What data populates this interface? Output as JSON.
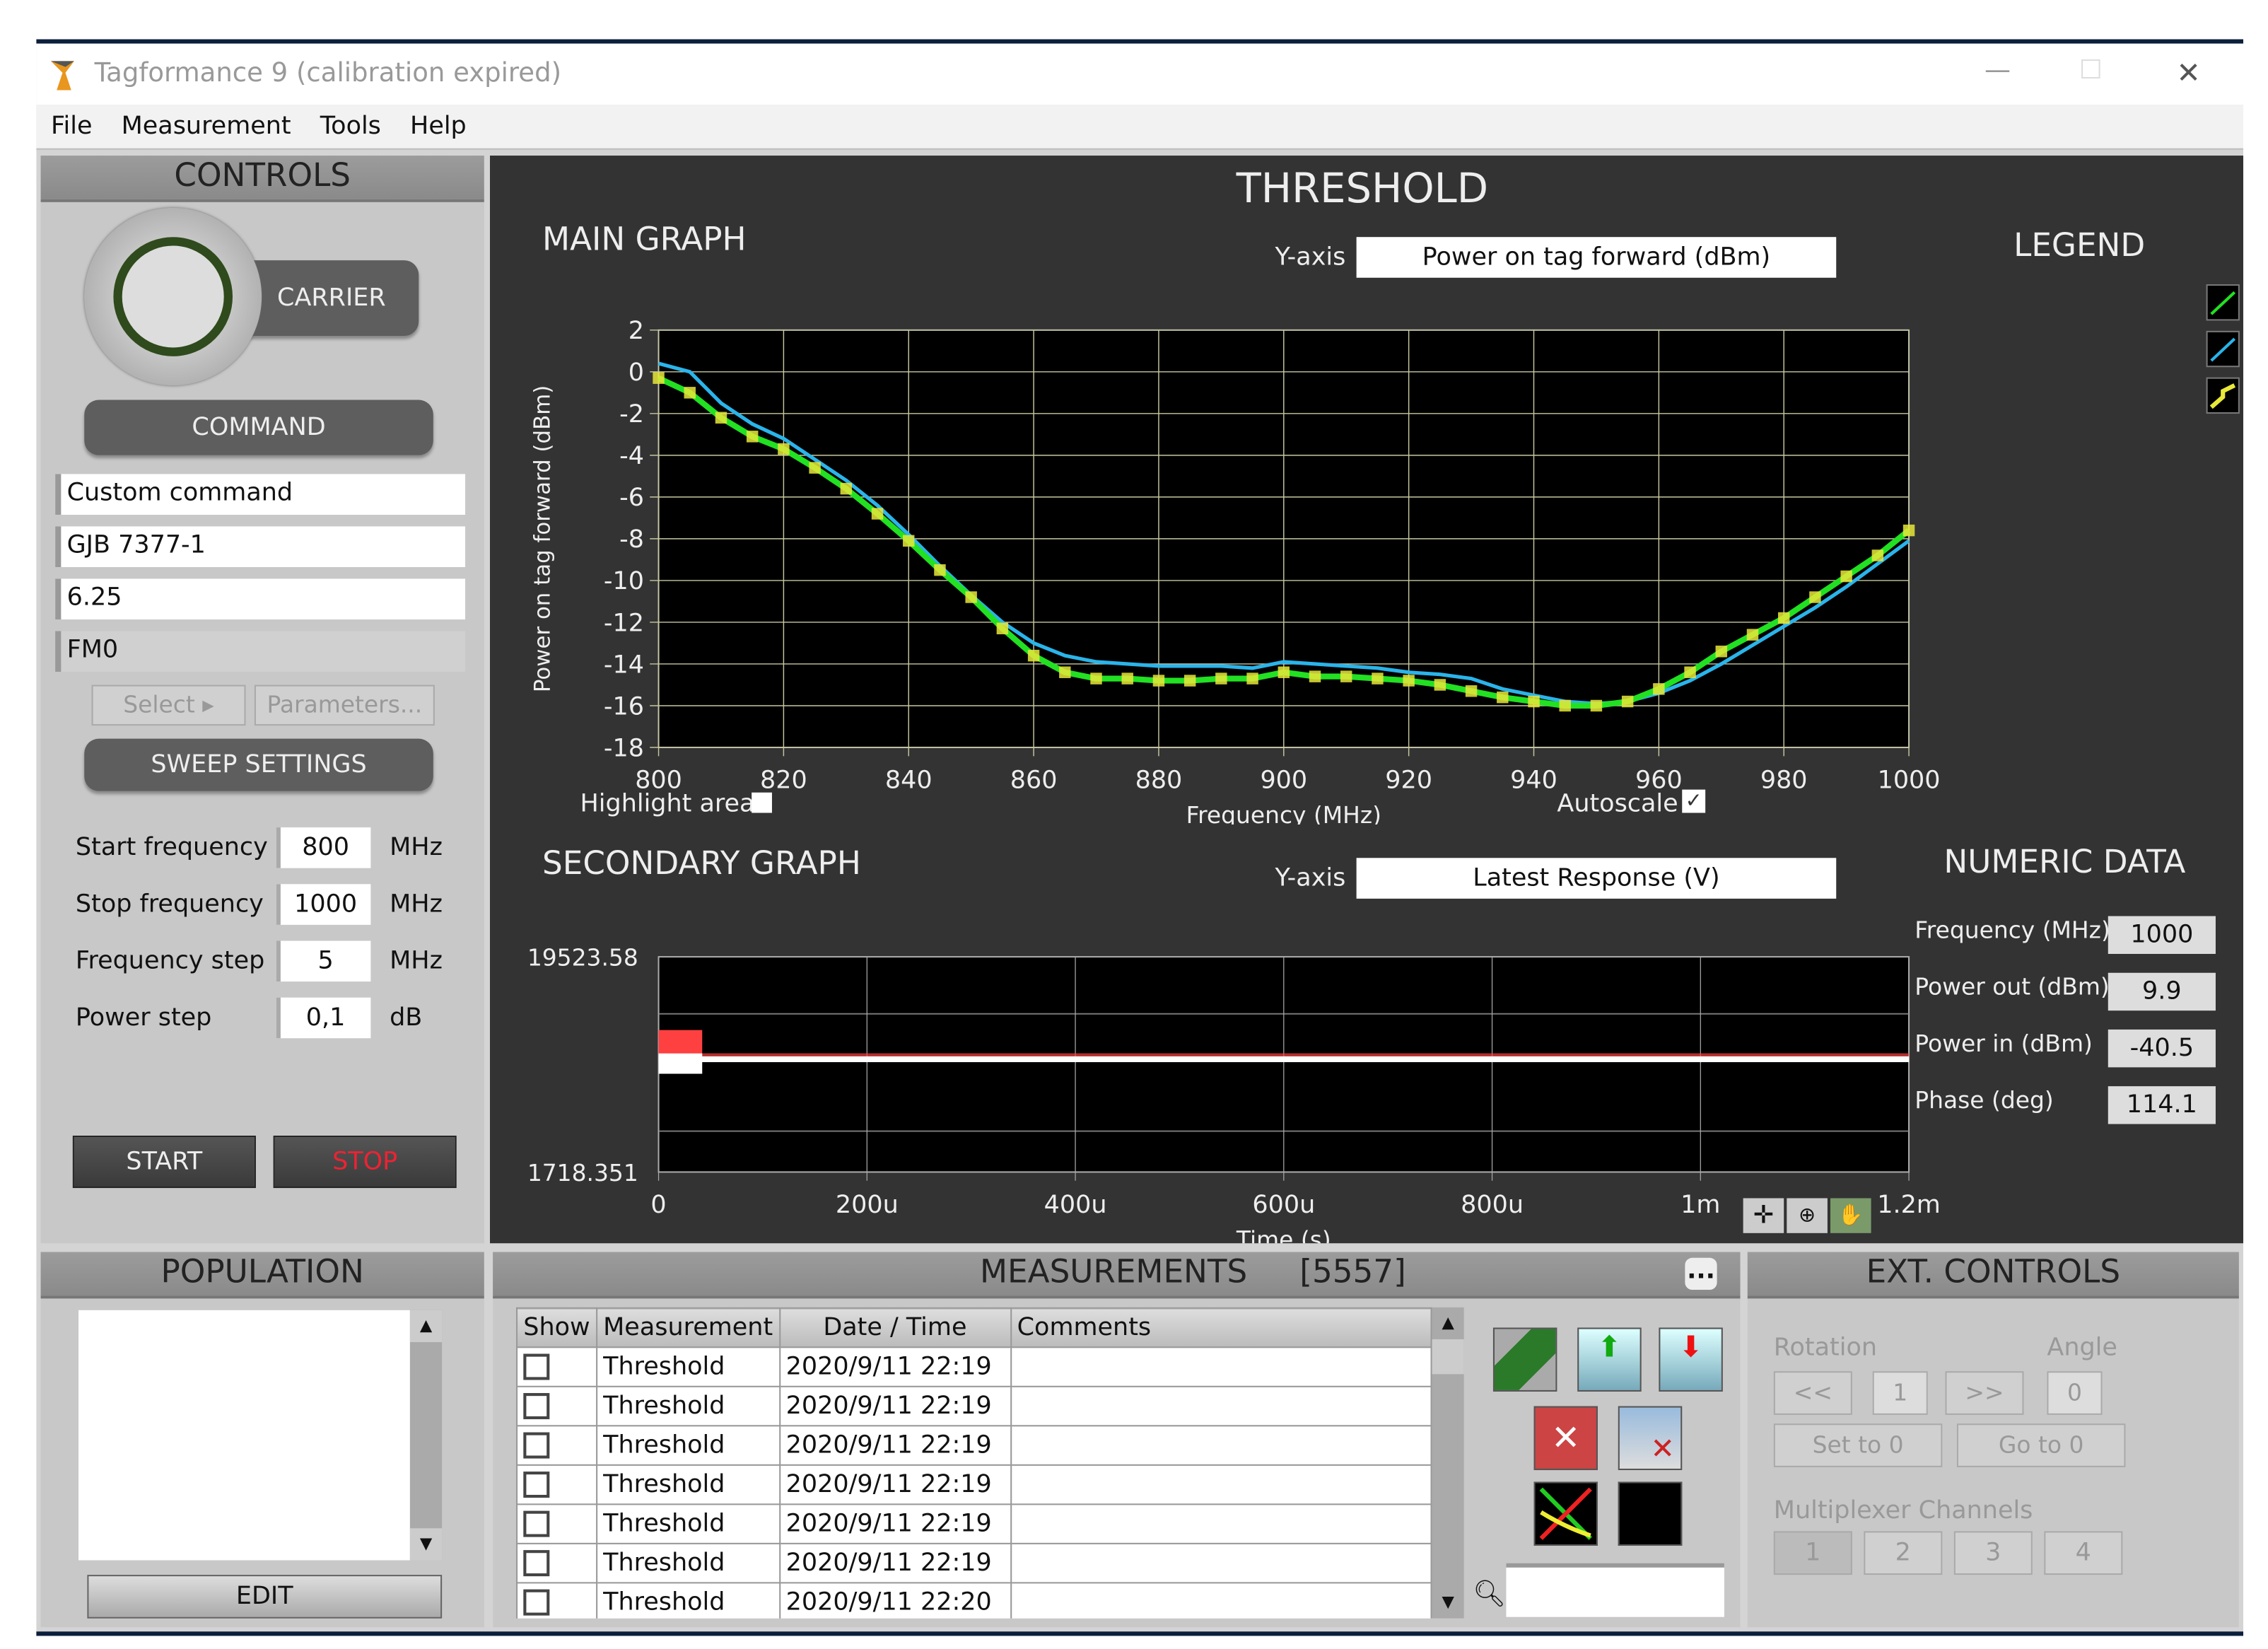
{
  "window": {
    "title": "Tagformance 9 (calibration expired)",
    "minimize": "—",
    "maximize": "☐",
    "close": "✕"
  },
  "menu": [
    "File",
    "Measurement",
    "Tools",
    "Help"
  ],
  "controls": {
    "header": "CONTROLS",
    "carrier": "CARRIER",
    "command": "COMMAND",
    "command_fields": [
      "Custom command",
      "GJB 7377-1",
      "6.25",
      "FM0"
    ],
    "select": "Select",
    "parameters": "Parameters...",
    "sweep_settings": "SWEEP SETTINGS",
    "sweep": [
      {
        "label": "Start frequency",
        "value": "800",
        "unit": "MHz"
      },
      {
        "label": "Stop frequency",
        "value": "1000",
        "unit": "MHz"
      },
      {
        "label": "Frequency step",
        "value": "5",
        "unit": "MHz"
      },
      {
        "label": "Power step",
        "value": "0,1",
        "unit": "dB"
      }
    ],
    "start": "START",
    "stop": "STOP"
  },
  "center": {
    "title": "THRESHOLD",
    "main_graph": "MAIN GRAPH",
    "yaxis_label": "Y-axis",
    "main_yaxis_value": "Power on tag forward (dBm)",
    "legend": "LEGEND",
    "highlight": "Highlight area",
    "autoscale": "Autoscale",
    "autoscale_checked": true,
    "highlight_checked": false,
    "secondary_graph": "SECONDARY GRAPH",
    "secondary_yaxis_value": "Latest Response (V)",
    "numeric_data": "NUMERIC DATA",
    "numeric": [
      {
        "label": "Frequency (MHz)",
        "value": "1000"
      },
      {
        "label": "Power out (dBm)",
        "value": "9.9"
      },
      {
        "label": "Power in (dBm)",
        "value": "-40.5"
      },
      {
        "label": "Phase (deg)",
        "value": "114.1"
      }
    ]
  },
  "chart_data": [
    {
      "type": "line",
      "title": "MAIN GRAPH",
      "xlabel": "Frequency (MHz)",
      "ylabel": "Power on tag forward (dBm)",
      "xlim": [
        800,
        1000
      ],
      "ylim": [
        -18,
        2
      ],
      "xticks": [
        "800",
        "820",
        "840",
        "860",
        "880",
        "900",
        "920",
        "940",
        "960",
        "980",
        "1000"
      ],
      "yticks": [
        "2",
        "0",
        "-2",
        "-4",
        "-6",
        "-8",
        "-10",
        "-12",
        "-14",
        "-16",
        "-18"
      ],
      "grid": true,
      "x": [
        800,
        805,
        810,
        815,
        820,
        825,
        830,
        835,
        840,
        845,
        850,
        855,
        860,
        865,
        870,
        875,
        880,
        885,
        890,
        895,
        900,
        905,
        910,
        915,
        920,
        925,
        930,
        935,
        940,
        945,
        950,
        955,
        960,
        965,
        970,
        975,
        980,
        985,
        990,
        995,
        1000
      ],
      "series": [
        {
          "name": "green",
          "color": "#22e022",
          "markers": "#e8e83a",
          "values": [
            -0.3,
            -1,
            -2.2,
            -3.1,
            -3.7,
            -4.6,
            -5.6,
            -6.8,
            -8.1,
            -9.5,
            -10.8,
            -12.3,
            -13.6,
            -14.4,
            -14.7,
            -14.7,
            -14.8,
            -14.8,
            -14.7,
            -14.7,
            -14.4,
            -14.6,
            -14.6,
            -14.7,
            -14.8,
            -15.0,
            -15.3,
            -15.6,
            -15.8,
            -16.0,
            -16.0,
            -15.8,
            -15.2,
            -14.4,
            -13.4,
            -12.6,
            -11.8,
            -10.8,
            -9.8,
            -8.8,
            -7.6
          ]
        },
        {
          "name": "cyan",
          "color": "#2ab4ea",
          "values": [
            0.4,
            0,
            -1.5,
            -2.5,
            -3.2,
            -4.2,
            -5.2,
            -6.4,
            -7.8,
            -9.3,
            -10.7,
            -12.0,
            -13.0,
            -13.6,
            -13.9,
            -14.0,
            -14.1,
            -14.1,
            -14.1,
            -14.2,
            -13.9,
            -14.0,
            -14.1,
            -14.2,
            -14.4,
            -14.5,
            -14.7,
            -15.2,
            -15.5,
            -15.8,
            -15.9,
            -15.8,
            -15.4,
            -14.8,
            -14.0,
            -13.1,
            -12.2,
            -11.3,
            -10.3,
            -9.2,
            -8.1
          ]
        }
      ]
    },
    {
      "type": "line",
      "title": "SECONDARY GRAPH",
      "xlabel": "Time (s)",
      "ylabel": "Latest Response (V)",
      "xlim": [
        0,
        0.0012
      ],
      "ylim": [
        1718.351,
        19523.58
      ],
      "xticks": [
        "0",
        "200u",
        "400u",
        "600u",
        "800u",
        "1m",
        "1.2m"
      ],
      "yticks": [
        "19523.58",
        "1718.351"
      ],
      "grid": true,
      "series": [
        {
          "name": "response",
          "color": "#ffffff",
          "approx_level": 11050
        },
        {
          "name": "envelope",
          "color": "#ff4040",
          "approx_level": 11300
        }
      ]
    }
  ],
  "population": {
    "header": "POPULATION",
    "edit": "EDIT"
  },
  "measurements": {
    "header": "MEASUREMENTS",
    "count": "[5557]",
    "more": "...",
    "columns": [
      "Show",
      "Measurement",
      "Date / Time",
      "Comments"
    ],
    "rows": [
      {
        "name": "Threshold",
        "date": "2020/9/11 22:19",
        "comment": ""
      },
      {
        "name": "Threshold",
        "date": "2020/9/11 22:19",
        "comment": ""
      },
      {
        "name": "Threshold",
        "date": "2020/9/11 22:19",
        "comment": ""
      },
      {
        "name": "Threshold",
        "date": "2020/9/11 22:19",
        "comment": ""
      },
      {
        "name": "Threshold",
        "date": "2020/9/11 22:19",
        "comment": ""
      },
      {
        "name": "Threshold",
        "date": "2020/9/11 22:19",
        "comment": ""
      },
      {
        "name": "Threshold",
        "date": "2020/9/11 22:20",
        "comment": ""
      }
    ],
    "search_value": ""
  },
  "ext": {
    "header": "EXT. CONTROLS",
    "rotation": "Rotation",
    "angle": "Angle",
    "prev": "<<",
    "rot_value": "1",
    "next": ">>",
    "angle_value": "0",
    "set0": "Set to 0",
    "goto0": "Go to 0",
    "mux": "Multiplexer Channels",
    "channels": [
      "1",
      "2",
      "3",
      "4"
    ]
  }
}
